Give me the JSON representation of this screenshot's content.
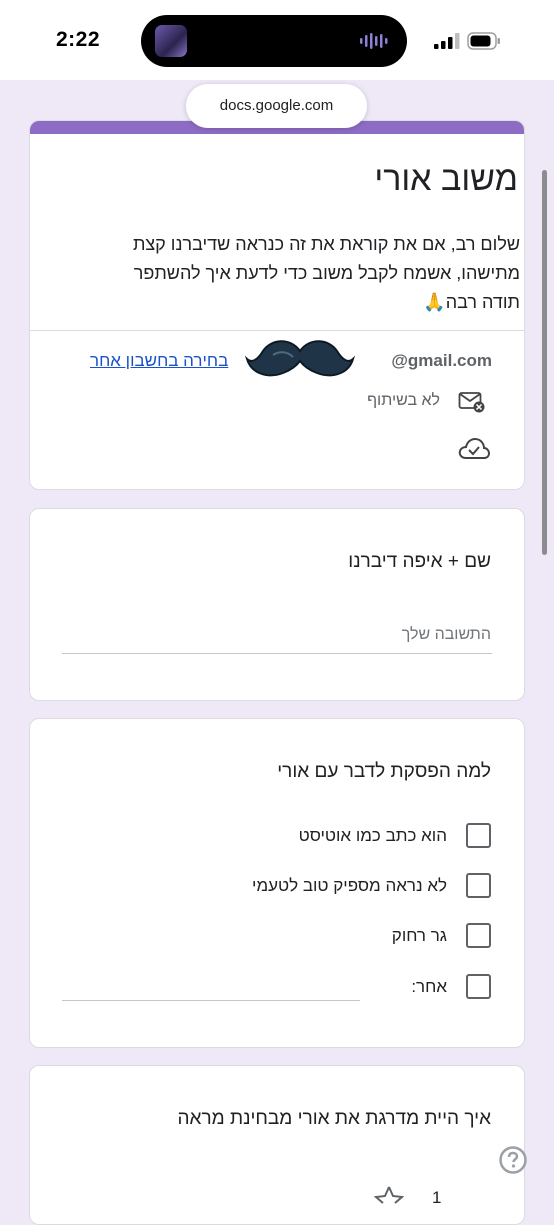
{
  "status_bar": {
    "time": "2:22"
  },
  "browser": {
    "url": "docs.google.com"
  },
  "form": {
    "title": "משוב אורי",
    "description_line1": "שלום רב, אם את קוראת את זה כנראה שדיברנו קצת",
    "description_line2": "מתישהו, אשמח לקבל משוב כדי לדעת איך להשתפר",
    "description_line3": "תודה רבה🙏",
    "account_email": "@gmail.com",
    "switch_account": "בחירה בחשבון אחר",
    "not_shared": "לא בשיתוף"
  },
  "questions": [
    {
      "title": "שם + איפה דיברנו",
      "placeholder": "התשובה שלך"
    },
    {
      "title": "למה הפסקת לדבר עם אורי",
      "options": [
        "הוא כתב כמו אוטיסט",
        "לא נראה מספיק טוב לטעמי",
        "גר רחוק",
        "אחר:"
      ]
    },
    {
      "title": "איך היית מדרגת את אורי מבחינת מראה",
      "rating_first": "1"
    }
  ],
  "icons": {
    "mail": "mail-off-icon",
    "cloud": "cloud-check-icon",
    "help": "help-icon",
    "star": "star-icon"
  },
  "colors": {
    "accent": "#8e6cc5",
    "background": "#efe9f7",
    "link": "#1a53c9"
  }
}
